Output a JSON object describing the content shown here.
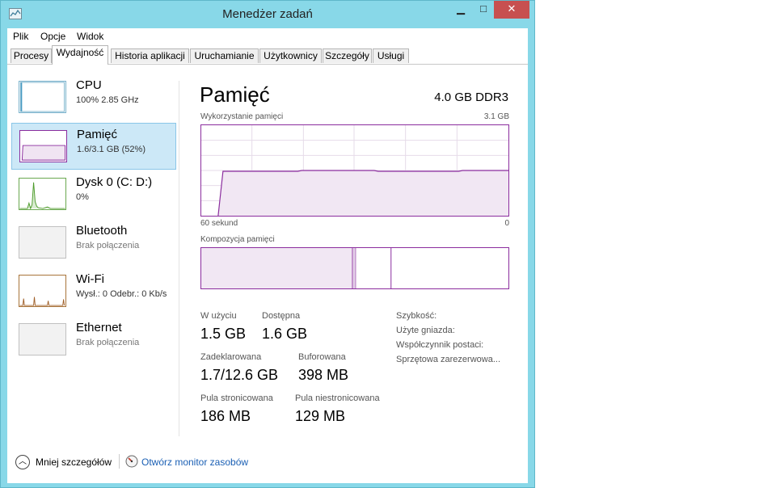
{
  "window": {
    "title": "Menedżer zadań",
    "min_glyph": "▁",
    "max_glyph": "□",
    "close_glyph": "✕"
  },
  "menu": {
    "items": [
      "Plik",
      "Opcje",
      "Widok"
    ]
  },
  "tabs": [
    "Procesy",
    "Wydajność",
    "Historia aplikacji",
    "Uruchamianie",
    "Użytkownicy",
    "Szczegóły",
    "Usługi"
  ],
  "active_tab": "Wydajność",
  "sidebar": {
    "items": [
      {
        "title": "CPU",
        "subtitle": "100%  2.85 GHz",
        "icon": "cpu-graph"
      },
      {
        "title": "Pamięć",
        "subtitle": "1.6/3.1 GB (52%)",
        "icon": "memory-graph"
      },
      {
        "title": "Dysk 0 (C: D:)",
        "subtitle": "0%",
        "icon": "disk-graph"
      },
      {
        "title": "Bluetooth",
        "subtitle": "Brak połączenia",
        "icon": "bluetooth-graph"
      },
      {
        "title": "Wi-Fi",
        "subtitle": "Wysł.: 0 Odebr.: 0 Kb/s",
        "icon": "wifi-graph"
      },
      {
        "title": "Ethernet",
        "subtitle": "Brak połączenia",
        "icon": "ethernet-graph"
      }
    ]
  },
  "main": {
    "title": "Pamięć",
    "spec": "4.0 GB DDR3",
    "usage_label": "Wykorzystanie pamięci",
    "usage_max": "3.1 GB",
    "time_label": "60 sekund",
    "time_end": "0",
    "composition_label": "Kompozycja pamięci",
    "stats": {
      "in_use_label": "W użyciu",
      "in_use_value": "1.5 GB",
      "available_label": "Dostępna",
      "available_value": "1.6 GB",
      "committed_label": "Zadeklarowana",
      "committed_value": "1.7/12.6 GB",
      "cached_label": "Buforowana",
      "cached_value": "398 MB",
      "paged_label": "Pula stronicowana",
      "paged_value": "186 MB",
      "nonpaged_label": "Pula niestronicowana",
      "nonpaged_value": "129 MB"
    },
    "right_labels": [
      "Szybkość:",
      "Użyte gniazda:",
      "Współczynnik postaci:",
      "Sprzętowa zarezerwowa..."
    ]
  },
  "footer": {
    "less_details": "Mniej szczegółów",
    "open_monitor": "Otwórz monitor zasobów"
  },
  "colors": {
    "window_frame": "#88d8e8",
    "memory_accent": "#8b2d9e",
    "selection": "#cce8f7",
    "link": "#1a5fb4"
  }
}
